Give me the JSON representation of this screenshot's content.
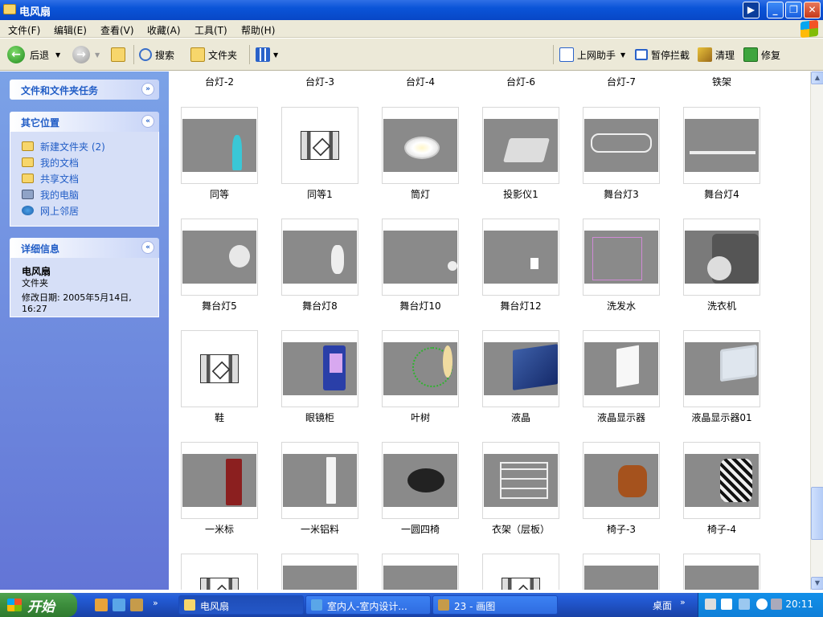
{
  "window": {
    "title": "电风扇"
  },
  "menu": [
    "文件(F)",
    "编辑(E)",
    "查看(V)",
    "收藏(A)",
    "工具(T)",
    "帮助(H)"
  ],
  "toolbar": {
    "back": "后退",
    "search": "搜索",
    "folders": "文件夹",
    "helper": "上网助手",
    "block": "暂停拦截",
    "clean": "清理",
    "repair": "修复"
  },
  "leftpane": {
    "tasks_title": "文件和文件夹任务",
    "places_title": "其它位置",
    "places": [
      "新建文件夹 (2)",
      "我的文档",
      "共享文档",
      "我的电脑",
      "网上邻居"
    ],
    "details_title": "详细信息",
    "details_name": "电风扇",
    "details_type": "文件夹",
    "details_modified_1": "修改日期: 2005年5月14日,",
    "details_modified_2": "16:27"
  },
  "content": {
    "top_labels": [
      "台灯-2",
      "台灯-3",
      "台灯-4",
      "台灯-6",
      "台灯-7",
      "铁架"
    ],
    "rows": [
      [
        "同等",
        "同等1",
        "筒灯",
        "投影仪1",
        "舞台灯3",
        "舞台灯4"
      ],
      [
        "舞台灯5",
        "舞台灯8",
        "舞台灯10",
        "舞台灯12",
        "洗发水",
        "洗衣机"
      ],
      [
        "鞋",
        "眼镜柜",
        "叶树",
        "液晶",
        "液晶显示器",
        "液晶显示器01"
      ],
      [
        "一米标",
        "一米铝料",
        "一圆四椅",
        "衣架（层板）",
        "椅子-3",
        "椅子-4"
      ]
    ]
  },
  "taskbar": {
    "start": "开始",
    "tasks": [
      "电风扇",
      "室内人-室内设计...",
      "23 - 画图"
    ],
    "desktop": "桌面",
    "clock": "20:11"
  }
}
